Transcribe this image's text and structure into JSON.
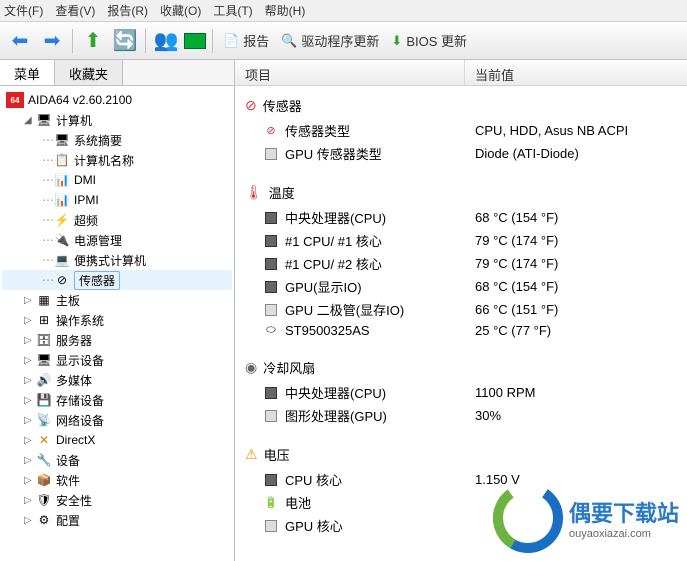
{
  "menubar": [
    "文件(F)",
    "查看(V)",
    "报告(R)",
    "收藏(O)",
    "工具(T)",
    "帮助(H)"
  ],
  "toolbar": {
    "report": "报告",
    "driver_update": "驱动程序更新",
    "bios_update": "BIOS 更新"
  },
  "tabs": {
    "menu": "菜单",
    "favorites": "收藏夹"
  },
  "tree": {
    "root": "AIDA64 v2.60.2100",
    "computer": {
      "label": "计算机",
      "children": [
        "系统摘要",
        "计算机名称",
        "DMI",
        "IPMI",
        "超频",
        "电源管理",
        "便携式计算机",
        "传感器"
      ]
    },
    "rest": [
      "主板",
      "操作系统",
      "服务器",
      "显示设备",
      "多媒体",
      "存储设备",
      "网络设备",
      "DirectX",
      "设备",
      "软件",
      "安全性",
      "配置"
    ]
  },
  "columns": {
    "item": "项目",
    "value": "当前值"
  },
  "groups": [
    {
      "title": "传感器",
      "icon": "⊘",
      "rows": [
        {
          "icon": "sensor",
          "label": "传感器类型",
          "value": "CPU, HDD, Asus NB ACPI"
        },
        {
          "icon": "gpu",
          "label": "GPU 传感器类型",
          "value": "Diode  (ATI-Diode)"
        }
      ]
    },
    {
      "title": "温度",
      "icon": "🌡",
      "rows": [
        {
          "icon": "chip",
          "label": "中央处理器(CPU)",
          "value": "68 °C  (154 °F)"
        },
        {
          "icon": "chip",
          "label": "#1 CPU/ #1 核心",
          "value": "79 °C  (174 °F)"
        },
        {
          "icon": "chip",
          "label": "#1 CPU/ #2 核心",
          "value": "79 °C  (174 °F)"
        },
        {
          "icon": "chip",
          "label": "GPU(显示IO)",
          "value": "68 °C  (154 °F)"
        },
        {
          "icon": "gpu",
          "label": "GPU 二极管(显存IO)",
          "value": "66 °C  (151 °F)"
        },
        {
          "icon": "hdd",
          "label": "ST9500325AS",
          "value": "25 °C  (77 °F)"
        }
      ]
    },
    {
      "title": "冷却风扇",
      "icon": "◉",
      "rows": [
        {
          "icon": "chip",
          "label": "中央处理器(CPU)",
          "value": "1100 RPM"
        },
        {
          "icon": "gpu",
          "label": "图形处理器(GPU)",
          "value": "30%"
        }
      ]
    },
    {
      "title": "电压",
      "icon": "⚠",
      "rows": [
        {
          "icon": "chip",
          "label": "CPU 核心",
          "value": "1.150 V"
        },
        {
          "icon": "bat",
          "label": "电池",
          "value": ""
        },
        {
          "icon": "gpu",
          "label": "GPU 核心",
          "value": ""
        }
      ]
    }
  ],
  "watermark": {
    "cn": "偶要下载站",
    "en": "ouyaoxiazai.com"
  }
}
